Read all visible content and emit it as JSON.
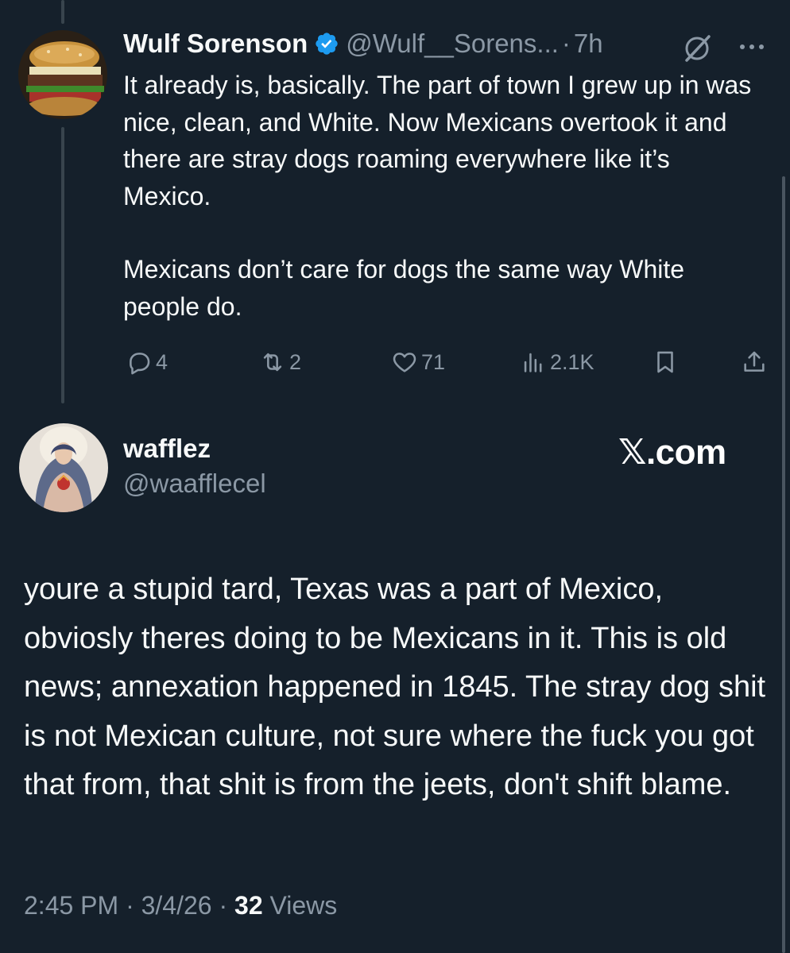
{
  "reply_parent": {
    "display_name": "Wulf Sorenson",
    "handle": "@Wulf__Sorens...",
    "separator": "·",
    "time": "7h",
    "avatar_icon": "burger-avatar",
    "verified_icon": "verified-badge-icon",
    "text_paragraphs": [
      "It already is, basically. The part of town I grew up in was nice, clean, and White. Now Mexicans overtook it and there are stray dogs roaming everywhere like it’s Mexico.",
      "Mexicans don’t care for dogs the same way White people do."
    ],
    "metrics": {
      "replies": "4",
      "reposts": "2",
      "likes": "71",
      "views": "2.1K"
    }
  },
  "main_tweet": {
    "display_name": "wafflez",
    "handle": "@waafflecel",
    "avatar_icon": "religious-painting-avatar",
    "text": "youre a stupid tard, Texas was a part of Mexico, obviosly theres doing to be Mexicans in it. This is old news; annexation happened in 1845. The stray dog shit is not Mexican culture, not sure where the fuck you got that from, that shit is from the jeets, don't shift blame.",
    "time": "2:45 PM",
    "sep1": "·",
    "date": "3/4/26",
    "sep2": "·",
    "views_count": "32",
    "views_label": "Views"
  },
  "brand": {
    "text": "𝕏.com"
  },
  "colors": {
    "background": "#15202b",
    "text": "#f7f9f9",
    "secondary": "#8b98a5",
    "verified": "#1d9bf0",
    "thread_line": "#38444d"
  }
}
